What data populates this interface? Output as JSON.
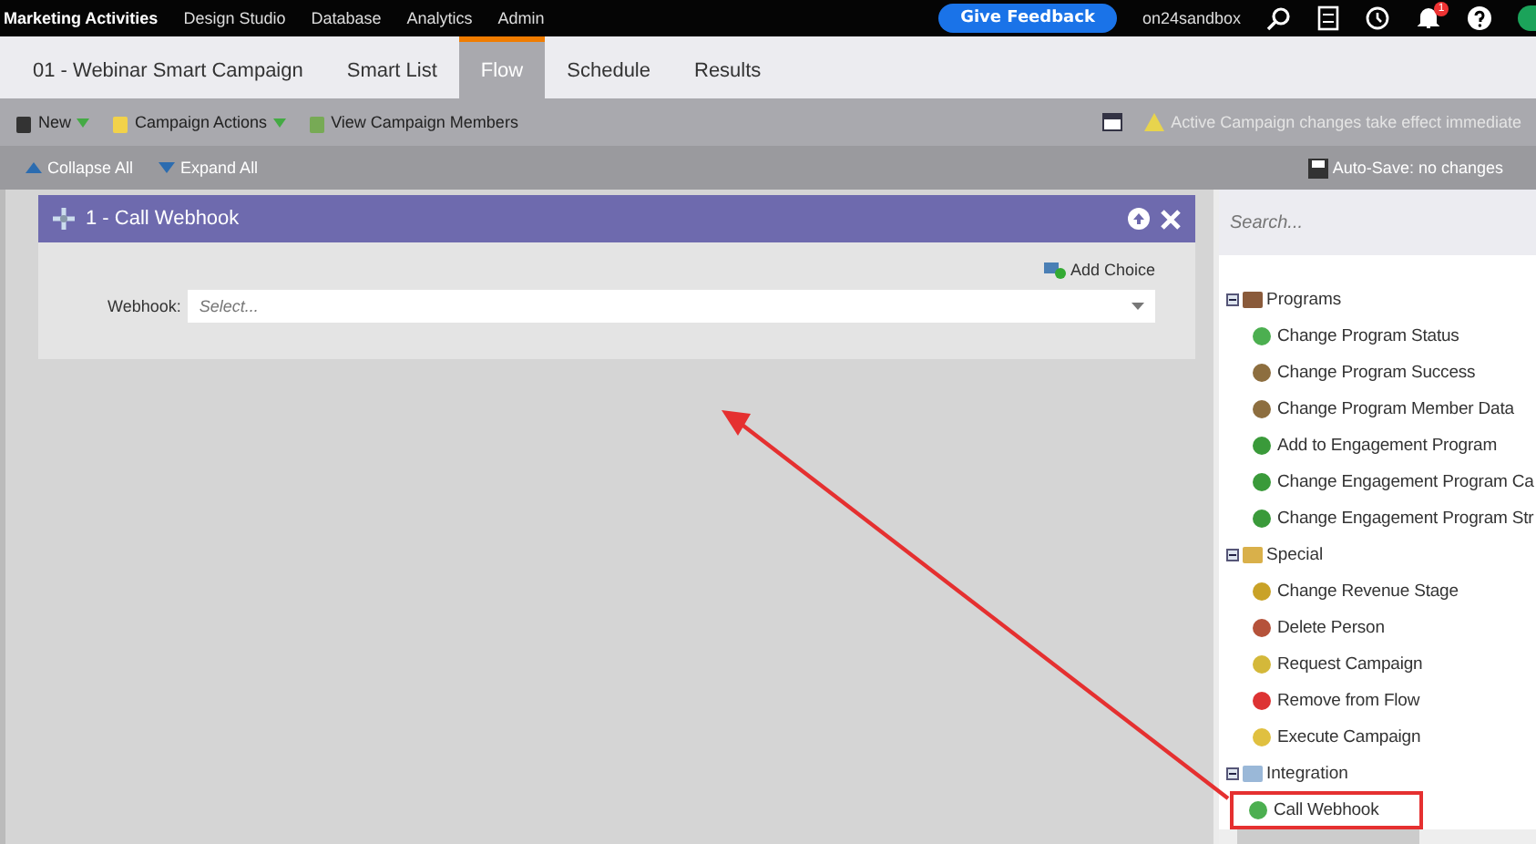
{
  "top_nav": {
    "items": [
      "Marketing Activities",
      "Design Studio",
      "Database",
      "Analytics",
      "Admin"
    ],
    "feedback_button": "Give Feedback",
    "workspace": "on24sandbox",
    "notification_badge": "1"
  },
  "tabs": [
    {
      "label": "01 - Webinar Smart Campaign",
      "selected": false
    },
    {
      "label": "Smart List",
      "selected": false
    },
    {
      "label": "Flow",
      "selected": true
    },
    {
      "label": "Schedule",
      "selected": false
    },
    {
      "label": "Results",
      "selected": false
    }
  ],
  "toolbar": {
    "items": [
      "New",
      "Campaign Actions",
      "View Campaign Members"
    ],
    "notice": "Active Campaign  changes take effect immediate"
  },
  "subtoolbar": {
    "collapse": "Collapse All",
    "expand": "Expand All",
    "autosave": "Auto-Save: no changes"
  },
  "flow_step": {
    "title": "1 - Call Webhook",
    "add_choice": "Add Choice",
    "field_label": "Webhook:",
    "placeholder": "Select..."
  },
  "palette": {
    "search_placeholder": "Search...",
    "groups": [
      {
        "label": "Programs",
        "expanded": true,
        "children": [
          {
            "label": "Change Program Status",
            "highlighted": false
          },
          {
            "label": "Change Program Success",
            "highlighted": false
          },
          {
            "label": "Change Program Member Data",
            "highlighted": false
          },
          {
            "label": "Add to Engagement Program",
            "highlighted": false
          },
          {
            "label": "Change Engagement Program Ca",
            "highlighted": false
          },
          {
            "label": "Change Engagement Program Str",
            "highlighted": false
          }
        ]
      },
      {
        "label": "Special",
        "expanded": true,
        "children": [
          {
            "label": "Change Revenue Stage",
            "highlighted": false
          },
          {
            "label": "Delete Person",
            "highlighted": false
          },
          {
            "label": "Request Campaign",
            "highlighted": false
          },
          {
            "label": "Remove from Flow",
            "highlighted": false
          },
          {
            "label": "Execute Campaign",
            "highlighted": false
          }
        ]
      },
      {
        "label": "Integration",
        "expanded": true,
        "children": [
          {
            "label": "Call Webhook",
            "highlighted": true
          }
        ]
      }
    ]
  }
}
